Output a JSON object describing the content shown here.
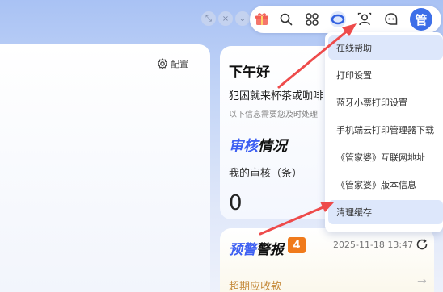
{
  "window_controls": [
    {
      "icon": "expand-icon",
      "glyph": "⤡"
    },
    {
      "icon": "close-icon",
      "glyph": "×"
    },
    {
      "icon": "chevron-down-icon",
      "glyph": "⌄"
    }
  ],
  "toolbar": {
    "avatar_label": "管",
    "icons": [
      "gift-icon",
      "search-icon",
      "apps-icon",
      "help-center-icon",
      "user-service-icon",
      "message-icon"
    ]
  },
  "left_panel": {
    "config_label": "配置"
  },
  "greeting": {
    "title": "下午好",
    "slogan": "犯困就来杯茶或咖啡",
    "hint": "以下信息需要您及时处理"
  },
  "audit": {
    "title_part1": "审核",
    "title_part2": "情况",
    "my_audit_label": "我的审核（条）",
    "count": "0"
  },
  "alert": {
    "title_part1": "预警",
    "title_part2": "警报",
    "badge": "4",
    "time": "2025-11-18 13:47",
    "overdue_label": "超期应收款"
  },
  "dropdown": {
    "items": [
      "在线帮助",
      "打印设置",
      "蓝牙小票打印设置",
      "手机端云打印管理器下载",
      "《管家婆》互联网地址",
      "《管家婆》版本信息",
      "清理缓存"
    ],
    "highlighted": [
      0,
      6
    ]
  },
  "colors": {
    "accent": "#3d6fe8",
    "warn_badge": "#f07a1c",
    "arrow": "#ee4b4b",
    "overdue_text": "#c5893a"
  }
}
